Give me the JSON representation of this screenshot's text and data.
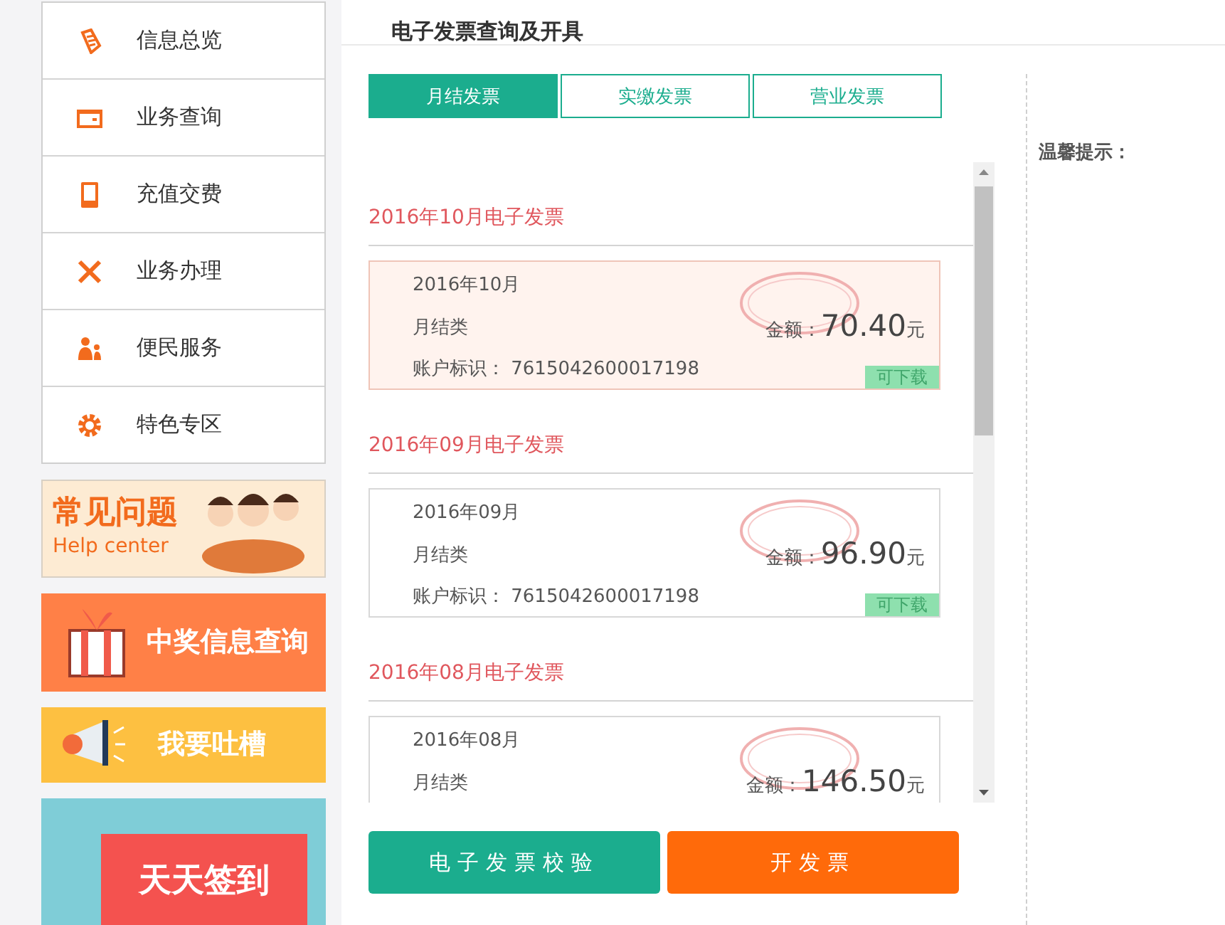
{
  "sidebar": {
    "items": [
      {
        "label": "信息总览",
        "kind": "scroll"
      },
      {
        "label": "业务查询",
        "kind": "wallet"
      },
      {
        "label": "充值交费",
        "kind": "phone"
      },
      {
        "label": "业务办理",
        "kind": "tools"
      },
      {
        "label": "便民服务",
        "kind": "people"
      },
      {
        "label": "特色专区",
        "kind": "gear"
      }
    ]
  },
  "banners": [
    {
      "kind": "help",
      "title": "常见问题",
      "subtitle": "Help center"
    },
    {
      "kind": "prize",
      "title": "中奖信息查询"
    },
    {
      "kind": "feedback",
      "title": "我要吐槽"
    },
    {
      "kind": "signin",
      "title": "天天签到"
    }
  ],
  "page_title": "电子发票查询及开具",
  "tabs": [
    {
      "label": "月结发票",
      "selected": true
    },
    {
      "label": "实缴发票",
      "selected": false
    },
    {
      "label": "营业发票",
      "selected": false
    }
  ],
  "tips_title": "温馨提示：",
  "invoice_groups": [
    {
      "heading": "2016年10月电子发票",
      "invoice": {
        "month": "2016年10月",
        "type": "月结类",
        "amount_label": "金额：",
        "amount": "70.40",
        "unit": "元",
        "account": "账户标识： 7615042600017198",
        "badge": "可下载",
        "selected": true
      }
    },
    {
      "heading": "2016年09月电子发票",
      "invoice": {
        "month": "2016年09月",
        "type": "月结类",
        "amount_label": "金额：",
        "amount": "96.90",
        "unit": "元",
        "account": "账户标识： 7615042600017198",
        "badge": "可下载",
        "selected": false
      }
    },
    {
      "heading": "2016年08月电子发票",
      "invoice": {
        "month": "2016年08月",
        "type": "月结类",
        "amount_label": "金额：",
        "amount": "146.50",
        "unit": "元",
        "selected": false
      }
    }
  ],
  "buttons": [
    {
      "label": "电子发票校验",
      "kind": "verify"
    },
    {
      "label": "开发票",
      "kind": "issue"
    }
  ]
}
